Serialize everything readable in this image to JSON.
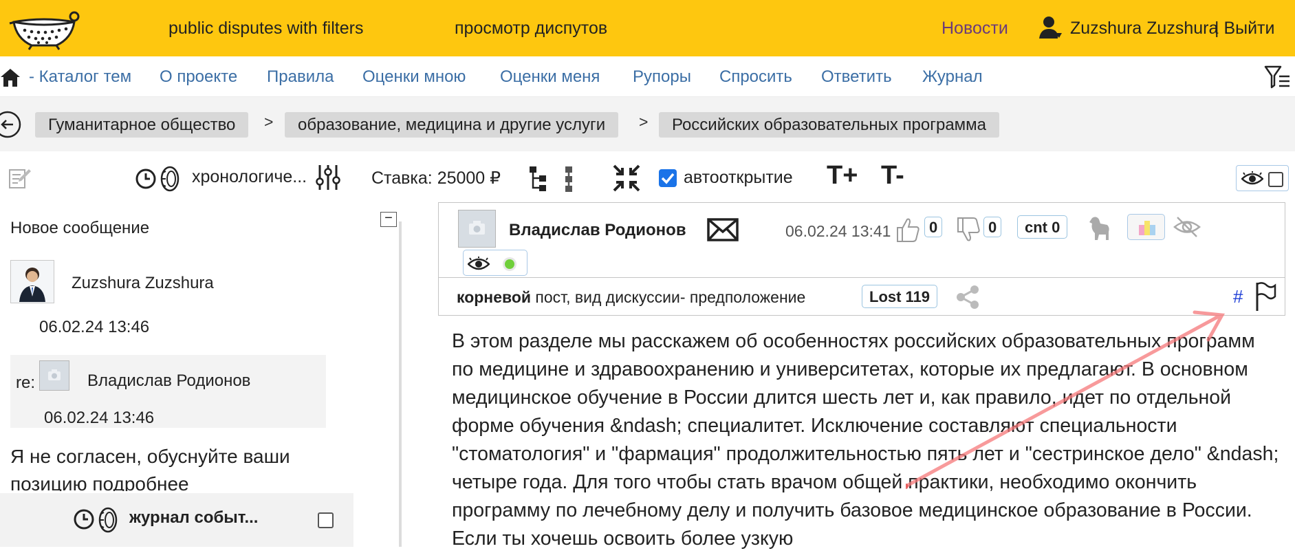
{
  "header": {
    "nav_title_1": "public disputes with filters",
    "nav_title_2": "просмотр диспутов",
    "news_link": "Новости",
    "user_name": "Zuzshura Zuzshura",
    "logout": "| Выйти"
  },
  "nav": {
    "items": [
      "- Каталог тем",
      "О проекте",
      "Правила",
      "Оценки мною",
      "Оценки меня",
      "Рупоры",
      "Спросить",
      "Ответить",
      "Журнал"
    ]
  },
  "breadcrumbs": {
    "items": [
      "Гуманитарное общество",
      "образование, медицина и другие услуги",
      "Российских образовательных программа"
    ],
    "separator": ">"
  },
  "toolbar": {
    "sort_label": "хронологиче...",
    "stake": "Ставка: 25000 ₽",
    "autoopen_label": "автооткрытие",
    "autoopen_checked": true,
    "font_increase": "T+",
    "font_decrease": "T-"
  },
  "left_panel": {
    "collapse_symbol": "−",
    "new_message_title": "Новое сообщение",
    "author": "Zuzshura Zuzshura",
    "date": "06.02.24 13:46",
    "reply_prefix": "re:",
    "reply_author": "Владислав Родионов",
    "reply_date": "06.02.24 13:46",
    "message_text": "Я не согласен, обуснуйте ваши позицию подробнее",
    "journal_label": "журнал событ..."
  },
  "post": {
    "author": "Владислав Родионов",
    "date": "06.02.24 13:41",
    "likes": "0",
    "dislikes": "0",
    "cnt": "cnt 0",
    "type_bold": "корневой",
    "type_rest": " пост, вид дискуссии- предположение",
    "lost": "Lost 119",
    "hash": "#",
    "body": "В этом разделе мы расскажем об особенностях российских образовательных программ по медицине и здравоохранению и университетах, которые их предлагают. В основном медицинское обучение в России длится шесть лет и, как правило, идет по отдельной форме обучения &ndash; специалитет. Исключение составляют специальности \"стоматология\" и \"фармация\" продолжительностью пять лет и \"сестринское дело\" &ndash; четыре года. Для того чтобы стать врачом общей практики, необходимо окончить программу по лечебному делу и получить базовое медицинское образование в России. Если ты хочешь освоить более узкую"
  },
  "colors": {
    "topbar": "#fec70f",
    "link": "#3b6ea5",
    "news": "#6b3a7a",
    "hash": "#1f3fd6",
    "arrow": "#f5787a"
  }
}
